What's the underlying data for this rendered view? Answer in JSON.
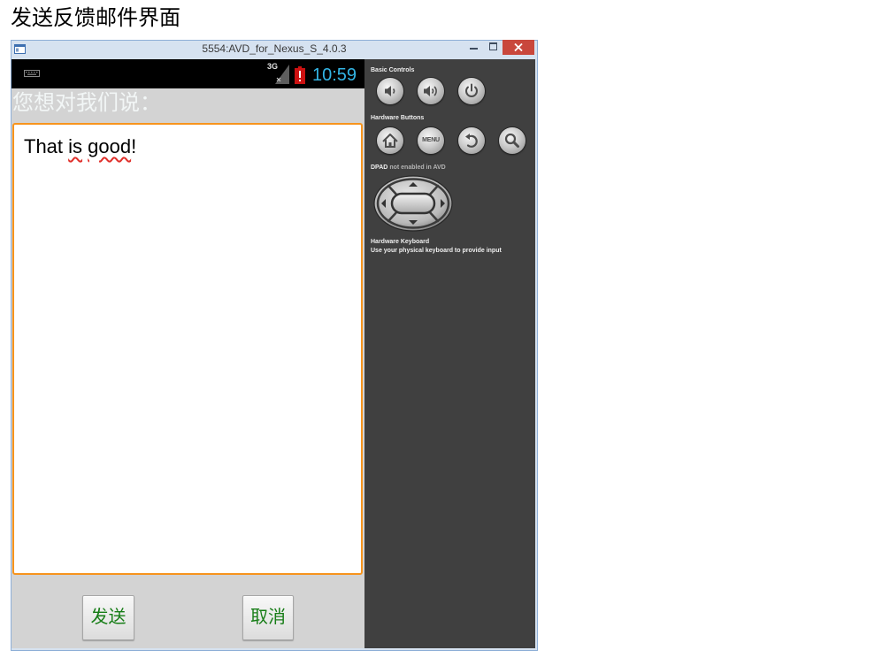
{
  "colors": {
    "app-bg": "#d3d3d3",
    "focus-border": "#f7941d",
    "button-text": "#177d17",
    "clock": "#33b5e5",
    "panel-bg": "#404040",
    "close-bg": "#c9473c"
  },
  "document": {
    "heading": "发送反馈邮件界面"
  },
  "window": {
    "title": "5554:AVD_for_Nexus_S_4.0.3",
    "icon": "app-window-icon",
    "controls": [
      "minimize-icon",
      "maximize-icon",
      "close-icon"
    ]
  },
  "status_bar": {
    "notification_icon": "keyboard-icon",
    "network_type": "3G",
    "signal_icon": "signal-no-data-icon",
    "battery_icon": "battery-alert-icon",
    "time": "10:59"
  },
  "app": {
    "prompt_label": "您想对我们说：",
    "message": {
      "segments": [
        {
          "text": "That ",
          "flagged": false
        },
        {
          "text": "is",
          "flagged": true
        },
        {
          "text": " ",
          "flagged": false
        },
        {
          "text": "good",
          "flagged": true
        },
        {
          "text": "!",
          "flagged": false
        }
      ]
    },
    "buttons": {
      "send": "发送",
      "cancel": "取消"
    }
  },
  "controls_panel": {
    "basic_controls": {
      "title": "Basic Controls",
      "buttons": [
        {
          "icon": "volume-down-icon"
        },
        {
          "icon": "volume-up-icon"
        },
        {
          "icon": "power-icon"
        }
      ]
    },
    "hardware_buttons": {
      "title": "Hardware Buttons",
      "buttons": [
        {
          "icon": "home-icon"
        },
        {
          "label": "MENU"
        },
        {
          "icon": "back-icon"
        },
        {
          "icon": "search-icon"
        }
      ]
    },
    "dpad": {
      "title": "DPAD",
      "note": "not enabled in AVD"
    },
    "hardware_keyboard": {
      "title": "Hardware Keyboard",
      "note": "Use your physical keyboard to provide input"
    }
  }
}
